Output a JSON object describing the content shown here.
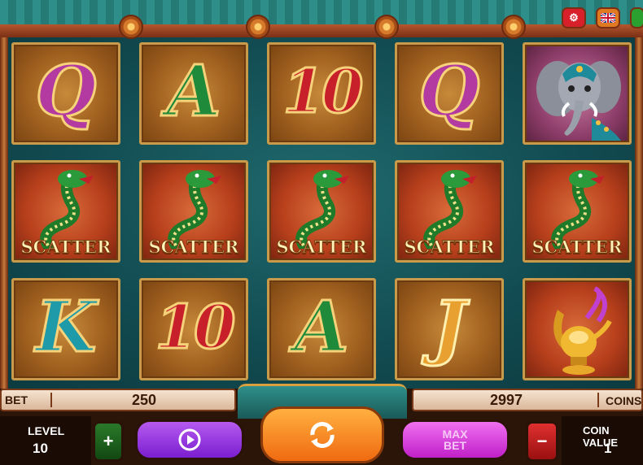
{
  "top_buttons": {
    "settings_icon": "gear-icon",
    "language_icon": "uk-flag-icon",
    "extra_icon": "close-icon"
  },
  "reels": [
    [
      {
        "symbol": "Q",
        "type": "letter"
      },
      {
        "symbol": "SCATTER",
        "type": "scatter"
      },
      {
        "symbol": "K",
        "type": "letter"
      }
    ],
    [
      {
        "symbol": "A",
        "type": "letter"
      },
      {
        "symbol": "SCATTER",
        "type": "scatter"
      },
      {
        "symbol": "10",
        "type": "letter"
      }
    ],
    [
      {
        "symbol": "10",
        "type": "letter"
      },
      {
        "symbol": "SCATTER",
        "type": "scatter"
      },
      {
        "symbol": "A",
        "type": "letter"
      }
    ],
    [
      {
        "symbol": "Q",
        "type": "letter"
      },
      {
        "symbol": "SCATTER",
        "type": "scatter"
      },
      {
        "symbol": "J",
        "type": "letter"
      }
    ],
    [
      {
        "symbol": "elephant",
        "type": "picture"
      },
      {
        "symbol": "SCATTER",
        "type": "scatter"
      },
      {
        "symbol": "lamp",
        "type": "picture"
      }
    ]
  ],
  "scatter_label": "SCATTER",
  "bet": {
    "label": "BET",
    "value": "250"
  },
  "coins": {
    "label": "COINS",
    "value": "2997"
  },
  "level": {
    "label": "LEVEL",
    "value": "10"
  },
  "coin_value": {
    "label": "COIN VALUE",
    "value": "1"
  },
  "buttons": {
    "plus": "+",
    "minus": "−",
    "autoplay_icon": "play-icon",
    "spin_icon": "refresh-icon",
    "maxbet_line1": "MAX",
    "maxbet_line2": "BET"
  }
}
